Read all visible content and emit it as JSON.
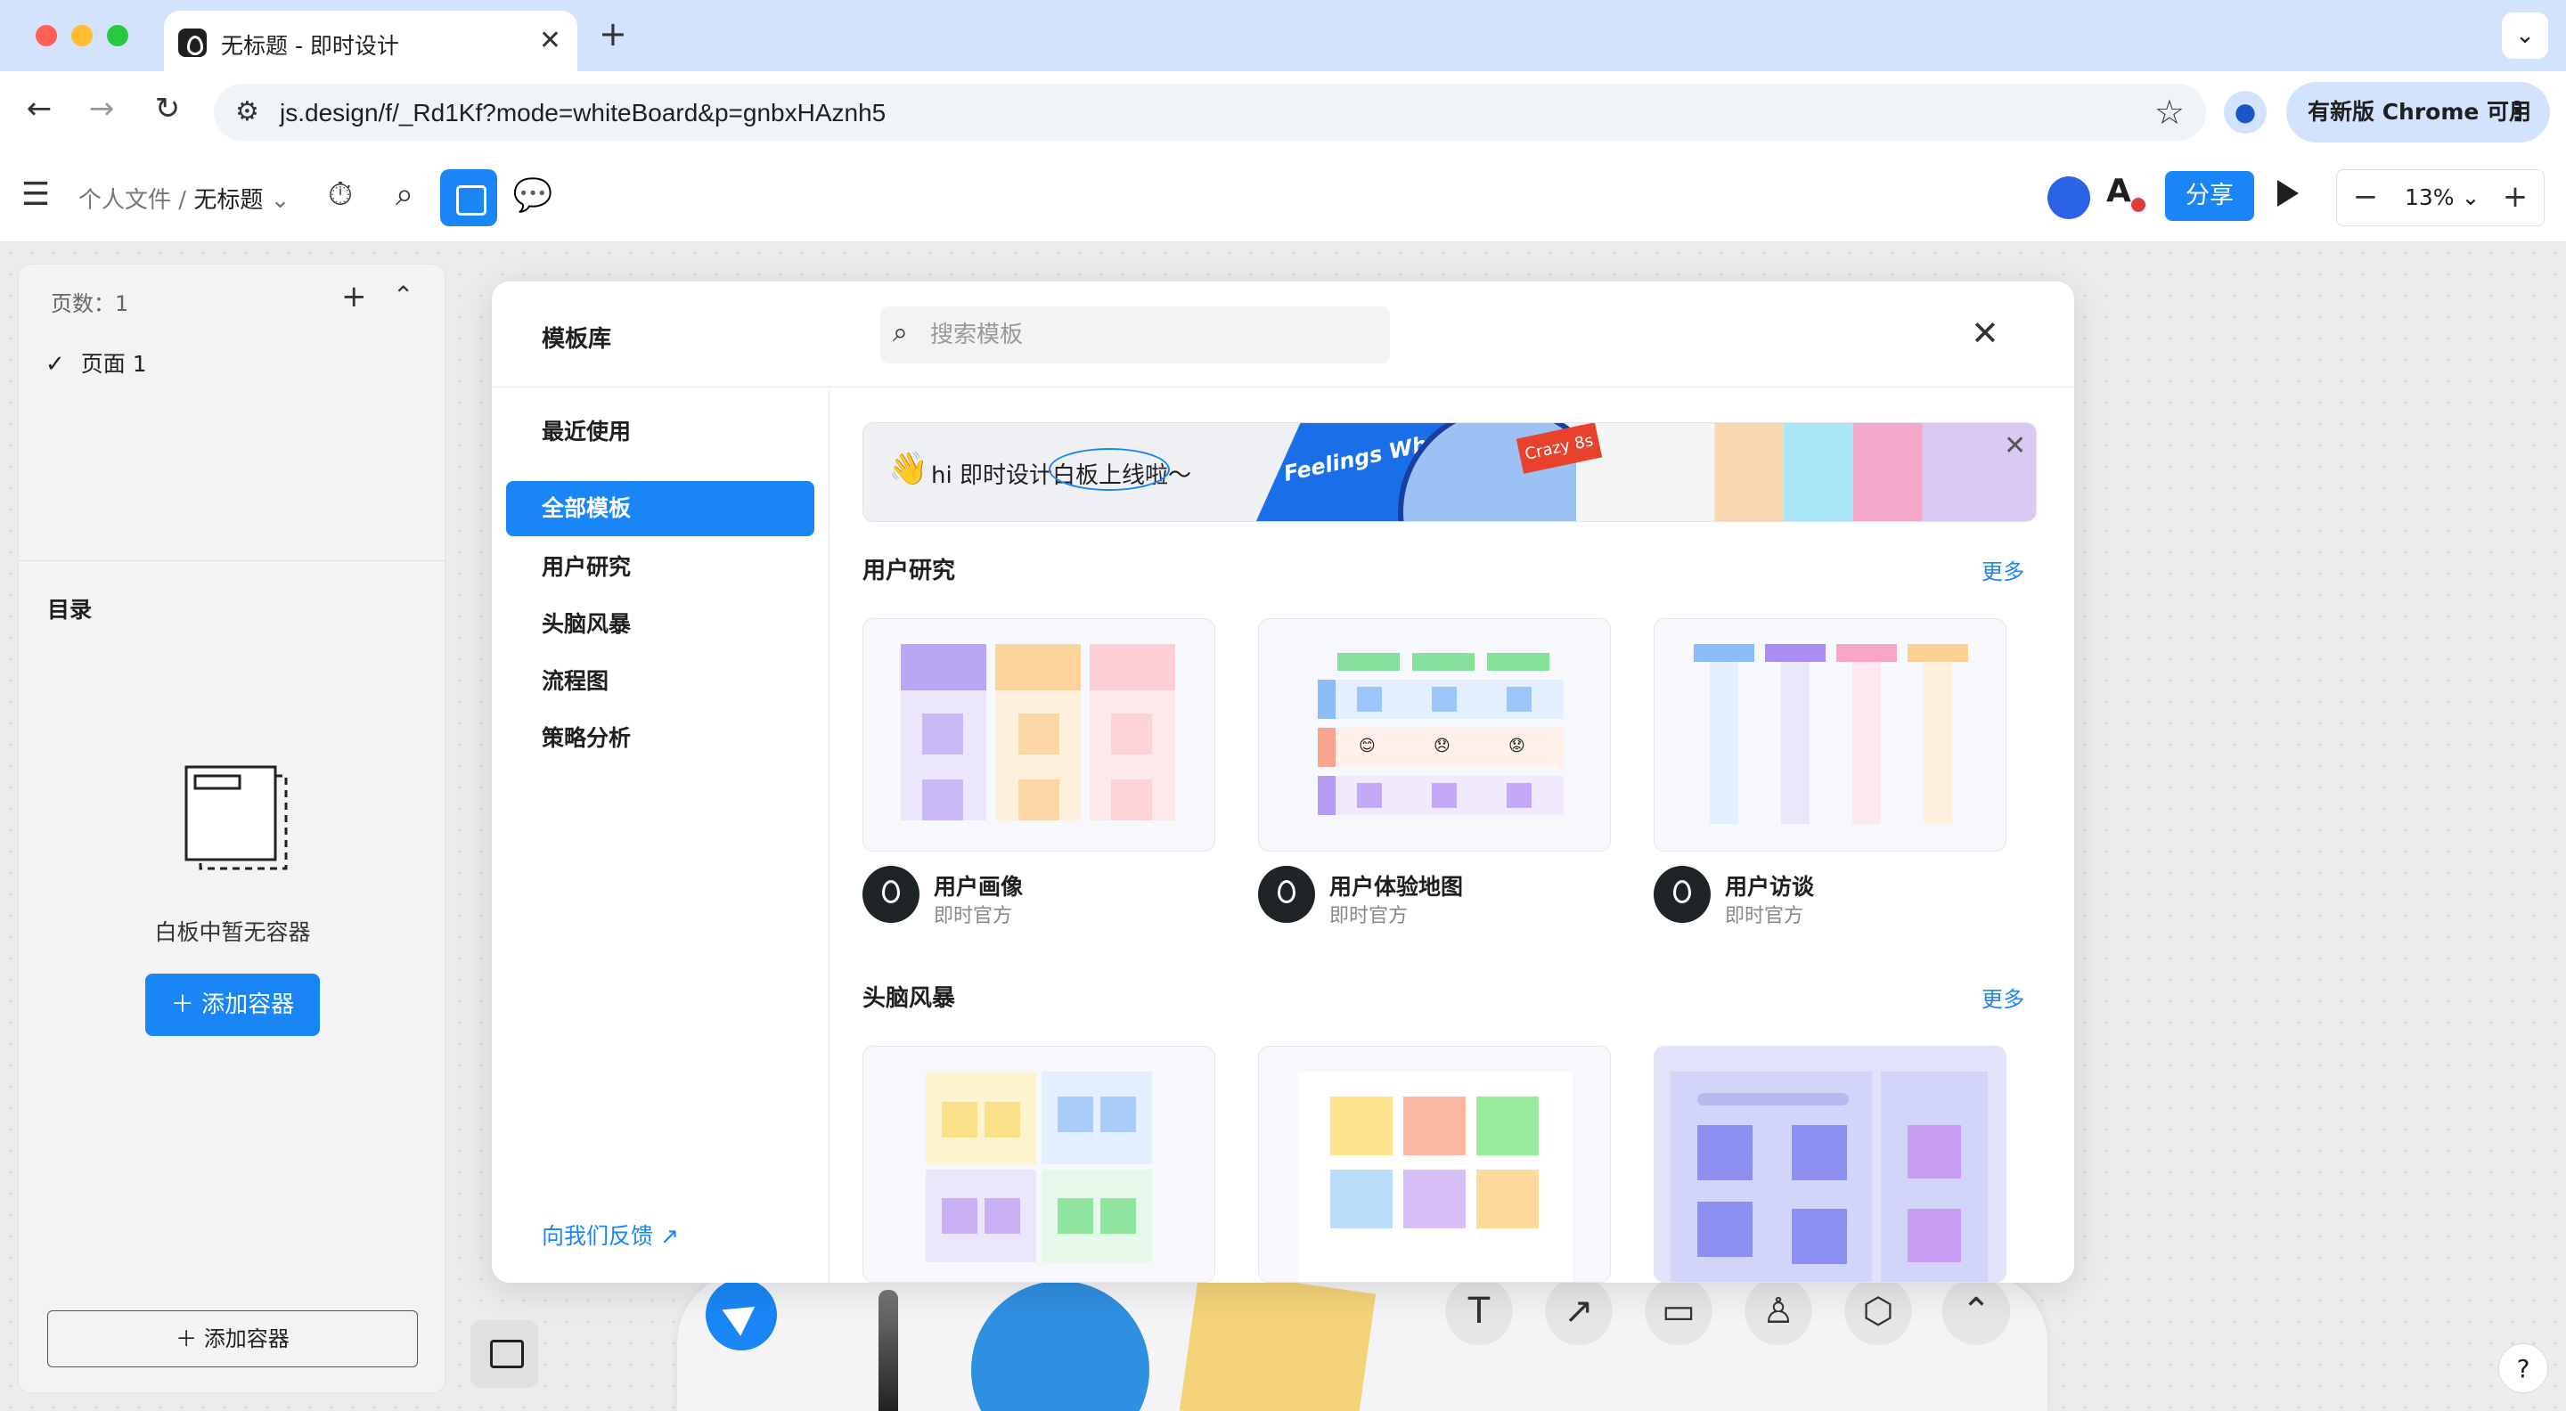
{
  "browser": {
    "tab_title": "无标题 - 即时设计",
    "new_tab": "+",
    "url": "js.design/f/_Rd1Kf?mode=whiteBoard&p=gnbxHAznh5",
    "update_button": "有新版 Chrome 可用",
    "colors": {
      "chrome_frame": "#d3e3fd",
      "close": "#fe5f57",
      "min": "#febc2e",
      "max": "#28c840"
    }
  },
  "app": {
    "breadcrumb_parent": "个人文件",
    "breadcrumb_sep": "/",
    "file_title": "无标题",
    "share_label": "分享",
    "zoom_level": "13%",
    "accent": "#1a86f5"
  },
  "left_panel": {
    "page_count": "页数：1",
    "pages": [
      {
        "label": "页面 1",
        "checked": true
      }
    ],
    "toc_title": "目录",
    "empty_text": "白板中暂无容器",
    "add_container": "添加容器",
    "add_container_bottom": "添加容器"
  },
  "modal": {
    "title": "模板库",
    "search_placeholder": "搜索模板",
    "categories": [
      {
        "label": "最近使用",
        "active": false
      },
      {
        "label": "全部模板",
        "active": true
      },
      {
        "label": "用户研究",
        "active": false
      },
      {
        "label": "头脑风暴",
        "active": false
      },
      {
        "label": "流程图",
        "active": false
      },
      {
        "label": "策略分析",
        "active": false
      }
    ],
    "feedback": "向我们反馈",
    "banner": {
      "prefix": "hi ",
      "highlight": "即时设计白板",
      "suffix": "上线啦～",
      "feelings": "Feelings Wheel",
      "crazy": "Crazy 8s"
    },
    "sections": [
      {
        "title": "用户研究",
        "more": "更多",
        "templates": [
          {
            "name": "用户画像",
            "author": "即时官方"
          },
          {
            "name": "用户体验地图",
            "author": "即时官方"
          },
          {
            "name": "用户访谈",
            "author": "即时官方"
          }
        ]
      },
      {
        "title": "头脑风暴",
        "more": "更多",
        "templates": []
      }
    ]
  }
}
